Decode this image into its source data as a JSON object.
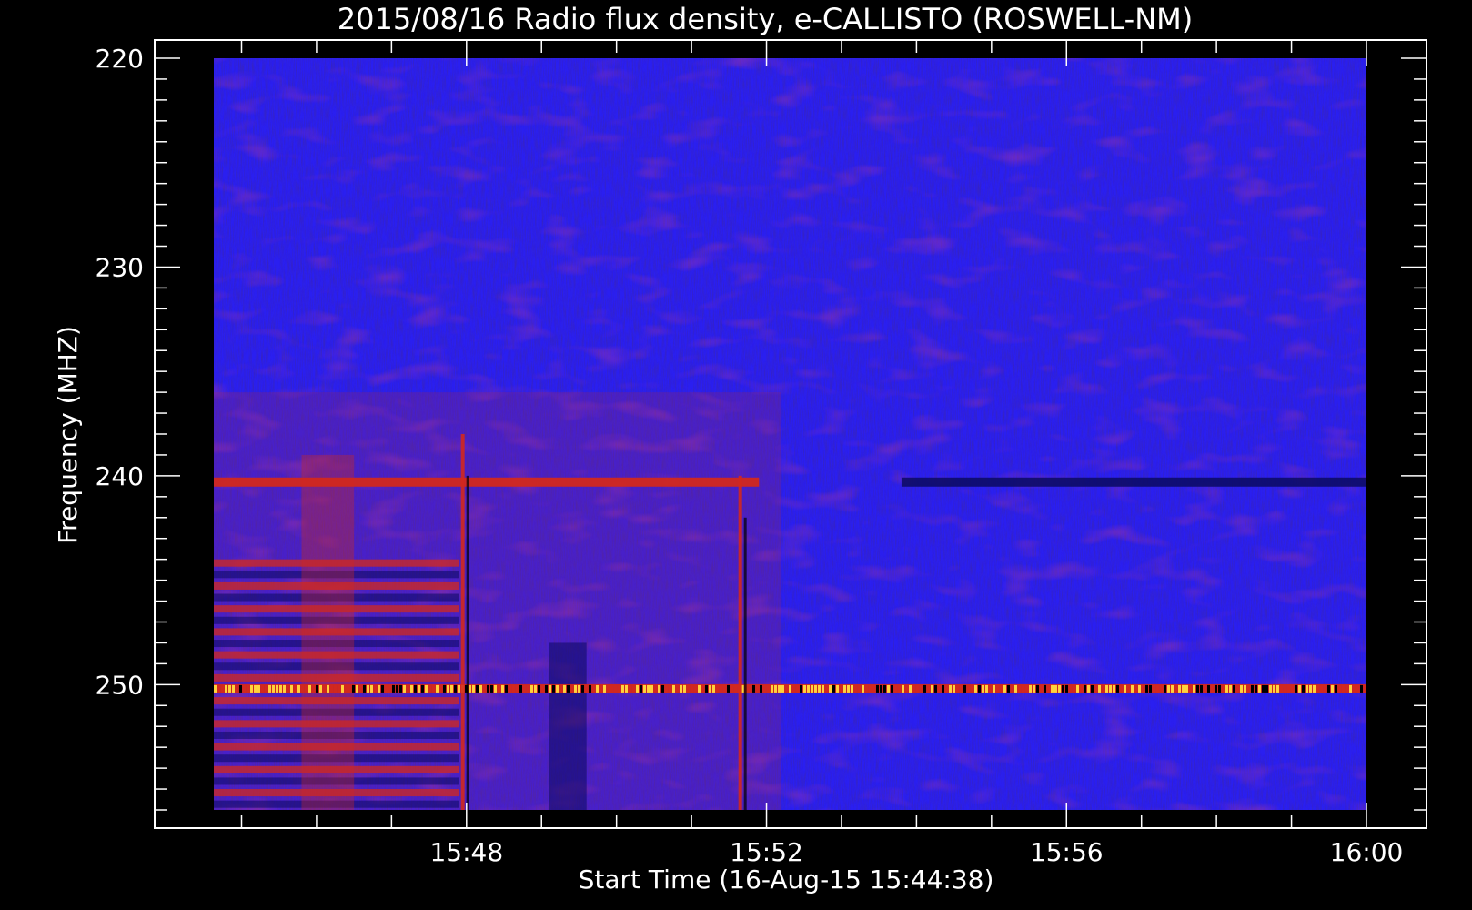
{
  "chart_data": {
    "type": "heatmap",
    "title": "2015/08/16  Radio flux density, e-CALLISTO (ROSWELL-NM)",
    "xlabel": "Start Time (16-Aug-15 15:44:38)",
    "ylabel": "Frequency (MHZ)",
    "x_ticks": [
      "15:48",
      "15:52",
      "15:56",
      "16:00"
    ],
    "x_tick_minutes": [
      48,
      52,
      56,
      60
    ],
    "xlim_minutes": [
      44.63,
      60.0
    ],
    "y_ticks": [
      220,
      230,
      240,
      250
    ],
    "ylim_mhz": [
      220,
      256
    ],
    "y_inverted": true,
    "colors": {
      "background": "#000000",
      "frame": "#ffffff",
      "base": "#2a1ff0",
      "dark": "#0a0a60",
      "red": "#d2281e",
      "bright": "#ffd23c"
    },
    "features": {
      "persistent_lines_mhz": [
        {
          "freq": 240.3,
          "start_min": 44.63,
          "end_min": 51.9,
          "level": "red"
        },
        {
          "freq": 240.3,
          "start_min": 53.8,
          "end_min": 60.0,
          "level": "dark"
        },
        {
          "freq": 250.2,
          "start_min": 44.63,
          "end_min": 60.0,
          "level": "bright"
        }
      ],
      "vertical_bursts_min": [
        {
          "time": 47.95,
          "freq_from": 238,
          "freq_to": 256
        },
        {
          "time": 51.65,
          "freq_from": 240,
          "freq_to": 256
        }
      ],
      "banded_region": {
        "start_min": 44.63,
        "end_min": 47.9,
        "freq_from": 244,
        "freq_to": 256
      }
    }
  }
}
